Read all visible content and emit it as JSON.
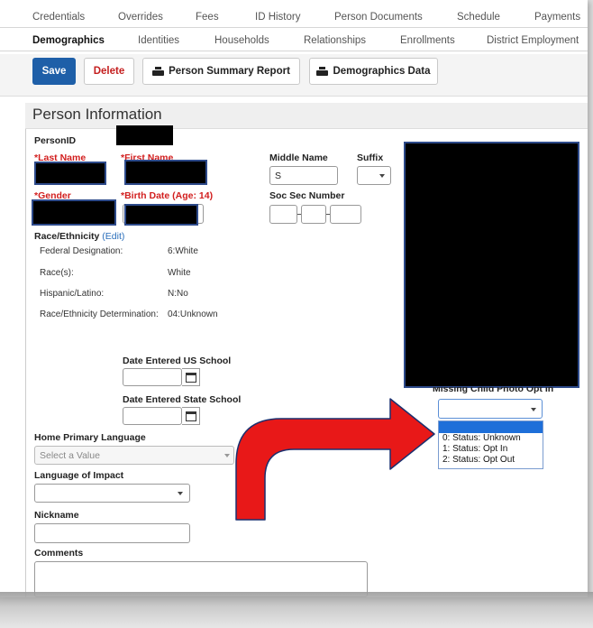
{
  "tabs_row1": [
    "Credentials",
    "Overrides",
    "Fees",
    "ID History",
    "Person Documents",
    "Schedule",
    "Payments"
  ],
  "tabs_row2": [
    "Demographics",
    "Identities",
    "Households",
    "Relationships",
    "Enrollments",
    "District Employment"
  ],
  "toolbar": {
    "save_label": "Save",
    "delete_label": "Delete",
    "summary_label": "Person Summary Report",
    "demographics_label": "Demographics Data"
  },
  "panel": {
    "title": "Person Information",
    "person_id_label": "PersonID",
    "last_name_label": "*Last Name",
    "first_name_label": "*First Name",
    "middle_name_label": "Middle Name",
    "middle_name_value": "S",
    "suffix_label": "Suffix",
    "gender_label": "*Gender",
    "birth_date_label": "*Birth Date (Age: 14)",
    "ssn_label": "Soc Sec Number",
    "race_label": "Race/Ethnicity",
    "race_edit_label": "(Edit)",
    "race_rows": [
      {
        "label": "Federal Designation:",
        "value": "6:White"
      },
      {
        "label": "Race(s):",
        "value": "White"
      },
      {
        "label": "Hispanic/Latino:",
        "value": "N:No"
      },
      {
        "label": "Race/Ethnicity Determination:",
        "value": "04:Unknown"
      }
    ],
    "date_us_label": "Date Entered US School",
    "date_state_label": "Date Entered State School",
    "missing_photo_label": "Missing Child Photo Opt In",
    "missing_photo_options": [
      "0: Status: Unknown",
      "1: Status: Opt In",
      "2: Status: Opt Out"
    ],
    "home_language_label": "Home Primary Language",
    "home_language_placeholder": "Select a Value",
    "impact_language_label": "Language of Impact",
    "nickname_label": "Nickname",
    "comments_label": "Comments"
  },
  "colors": {
    "save_button": "#1e5fa8",
    "required_label": "#d21e1e",
    "arrow": "#e81818",
    "dropdown_highlight": "#1e6fd9"
  }
}
